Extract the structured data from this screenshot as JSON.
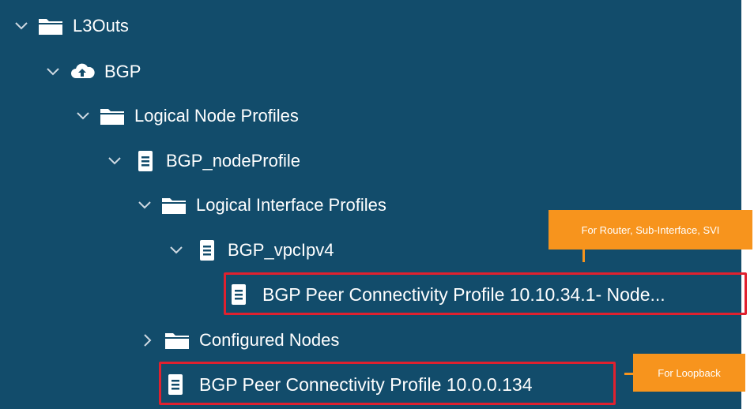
{
  "tree": {
    "items": [
      {
        "label": "L3Outs",
        "icon": "folder-icon",
        "expanded": true
      },
      {
        "label": "BGP",
        "icon": "cloud-upload-icon",
        "expanded": true
      },
      {
        "label": "Logical Node Profiles",
        "icon": "folder-icon",
        "expanded": true
      },
      {
        "label": "BGP_nodeProfile",
        "icon": "document-icon",
        "expanded": true
      },
      {
        "label": "Logical Interface Profiles",
        "icon": "folder-icon",
        "expanded": true
      },
      {
        "label": "BGP_vpcIpv4",
        "icon": "document-icon",
        "expanded": true
      },
      {
        "label": "BGP Peer Connectivity Profile 10.10.34.1- Node...",
        "icon": "document-icon",
        "highlighted": true
      },
      {
        "label": "Configured Nodes",
        "icon": "folder-icon",
        "expanded": false
      },
      {
        "label": "BGP Peer Connectivity Profile 10.0.0.134",
        "icon": "document-icon",
        "highlighted": true
      }
    ]
  },
  "callouts": {
    "router": "For Router, Sub-Interface, SVI",
    "loopback": "For Loopback"
  },
  "colors": {
    "panel": "#124c6b",
    "highlight": "#e0212f",
    "callout": "#f7941d",
    "text": "#ffffff"
  }
}
